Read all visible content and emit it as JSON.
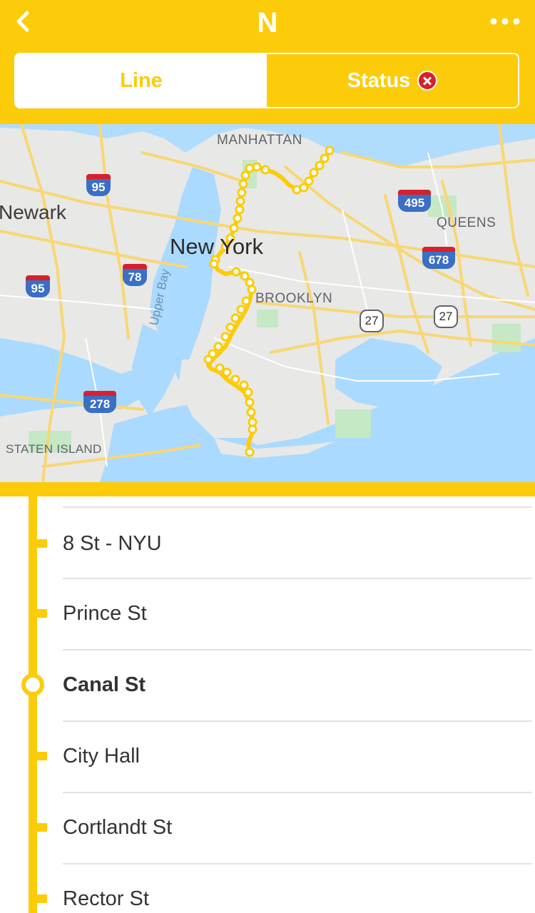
{
  "header": {
    "back_icon": "chevron-left-icon",
    "line_name": "N",
    "more_icon": "ellipsis-icon",
    "accent_color": "#FCCC0A"
  },
  "tabs": [
    {
      "label": "Line",
      "selected": true
    },
    {
      "label": "Status",
      "selected": false,
      "status_icon": "alert-x-icon",
      "status_color": "#d8202b"
    }
  ],
  "map": {
    "labels": {
      "manhattan": "MANHATTAN",
      "newark": "Newark",
      "new_york": "New York",
      "queens": "QUEENS",
      "brooklyn": "BROOKLYN",
      "staten_island": "STATEN ISLAND",
      "upper_bay": "Upper Bay"
    },
    "highway_shields": [
      "95",
      "495",
      "78",
      "95",
      "678",
      "278"
    ],
    "route_markers": [
      "27",
      "27"
    ]
  },
  "stations": [
    {
      "name": "8 St - NYU",
      "current": false
    },
    {
      "name": "Prince St",
      "current": false
    },
    {
      "name": "Canal St",
      "current": true
    },
    {
      "name": "City Hall",
      "current": false
    },
    {
      "name": "Cortlandt St",
      "current": false
    },
    {
      "name": "Rector St",
      "current": false
    }
  ]
}
